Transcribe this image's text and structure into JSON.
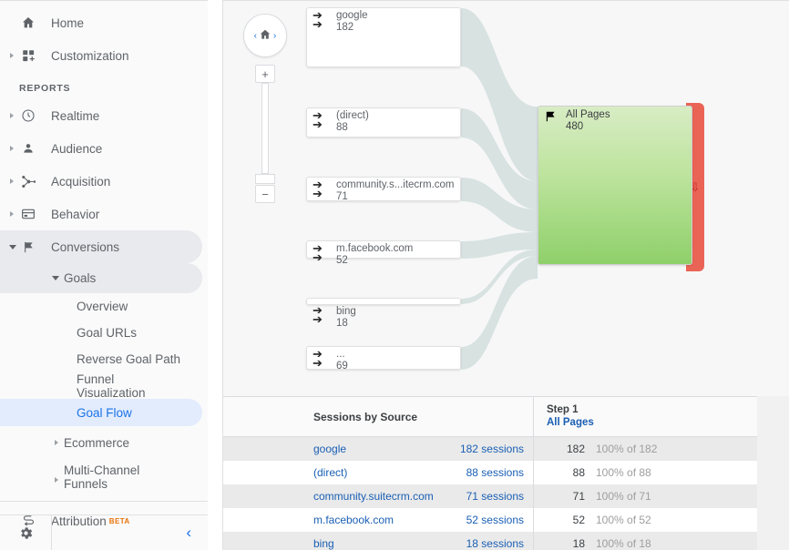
{
  "sidebar": {
    "items": [
      {
        "label": "Home",
        "icon": "home-icon",
        "expandable": false
      },
      {
        "label": "Customization",
        "icon": "customization-icon",
        "expandable": true
      }
    ],
    "section_label": "REPORTS",
    "reports": [
      {
        "label": "Realtime",
        "icon": "clock-icon",
        "expandable": true
      },
      {
        "label": "Audience",
        "icon": "person-icon",
        "expandable": true
      },
      {
        "label": "Acquisition",
        "icon": "acquisition-icon",
        "expandable": true
      },
      {
        "label": "Behavior",
        "icon": "behavior-icon",
        "expandable": true
      },
      {
        "label": "Conversions",
        "icon": "flag-icon",
        "expandable": true,
        "expanded": true
      }
    ],
    "goals": {
      "label": "Goals",
      "children": [
        {
          "label": "Overview"
        },
        {
          "label": "Goal URLs"
        },
        {
          "label": "Reverse Goal Path"
        },
        {
          "label": "Funnel Visualization",
          "line1": "Funnel",
          "line2": "Visualization"
        },
        {
          "label": "Goal Flow",
          "selected": true
        }
      ]
    },
    "ecommerce": {
      "label": "Ecommerce"
    },
    "multichannel": {
      "label": "Multi-Channel Funnels",
      "line1": "Multi-Channel",
      "line2": "Funnels"
    },
    "attribution": {
      "label": "Attribution",
      "badge": "BETA",
      "icon": "attribution-icon"
    },
    "footer": {
      "settings_icon": "gear-icon",
      "collapse_icon": "chevron-left-icon"
    }
  },
  "zoom_control": {
    "home_icon": "home-icon",
    "prev_icon": "chevron-left-icon",
    "next_icon": "chevron-right-icon",
    "zoom_in_label": "+",
    "zoom_out_label": "−"
  },
  "chart_data": {
    "type": "sankey",
    "title": "Goal Flow",
    "source_icon": "traffic-source-icon",
    "destination_icon": "flag-icon",
    "categories": [
      "google",
      "(direct)",
      "community.s...itecrm.com",
      "m.facebook.com",
      "bing",
      "..."
    ],
    "values": [
      182,
      88,
      71,
      52,
      18,
      69
    ],
    "nodes": [
      {
        "label": "google",
        "value": 182
      },
      {
        "label": "(direct)",
        "value": 88
      },
      {
        "label": "community.s...itecrm.com",
        "value": 71
      },
      {
        "label": "m.facebook.com",
        "value": 52
      },
      {
        "label": "bing",
        "value": 18
      },
      {
        "label": "...",
        "value": 69
      }
    ],
    "destination": {
      "label": "All Pages",
      "value": 480
    },
    "dropoff": {
      "icon": "down-arrow-icon"
    },
    "colors": {
      "ribbon": "#d7e2e1",
      "node_fill": "#ffffff",
      "destination_gradient_top": "#d8ecc4",
      "destination_gradient_bottom": "#8fd06a",
      "dropoff": "#ea6456",
      "link_text": "#1a5fb4",
      "selected_nav": "#1a73e8"
    }
  },
  "table": {
    "headers": {
      "source": "Sessions by Source",
      "step_line1": "Step 1",
      "step_line2": "All Pages"
    },
    "rows": [
      {
        "source": "google",
        "sessions": "182 sessions",
        "count": "182",
        "pct": "100% of 182"
      },
      {
        "source": "(direct)",
        "sessions": "88 sessions",
        "count": "88",
        "pct": "100% of 88"
      },
      {
        "source": "community.suitecrm.com",
        "sessions": "71 sessions",
        "count": "71",
        "pct": "100% of 71"
      },
      {
        "source": "m.facebook.com",
        "sessions": "52 sessions",
        "count": "52",
        "pct": "100% of 52"
      },
      {
        "source": "bing",
        "sessions": "18 sessions",
        "count": "18",
        "pct": "100% of 18"
      }
    ]
  }
}
